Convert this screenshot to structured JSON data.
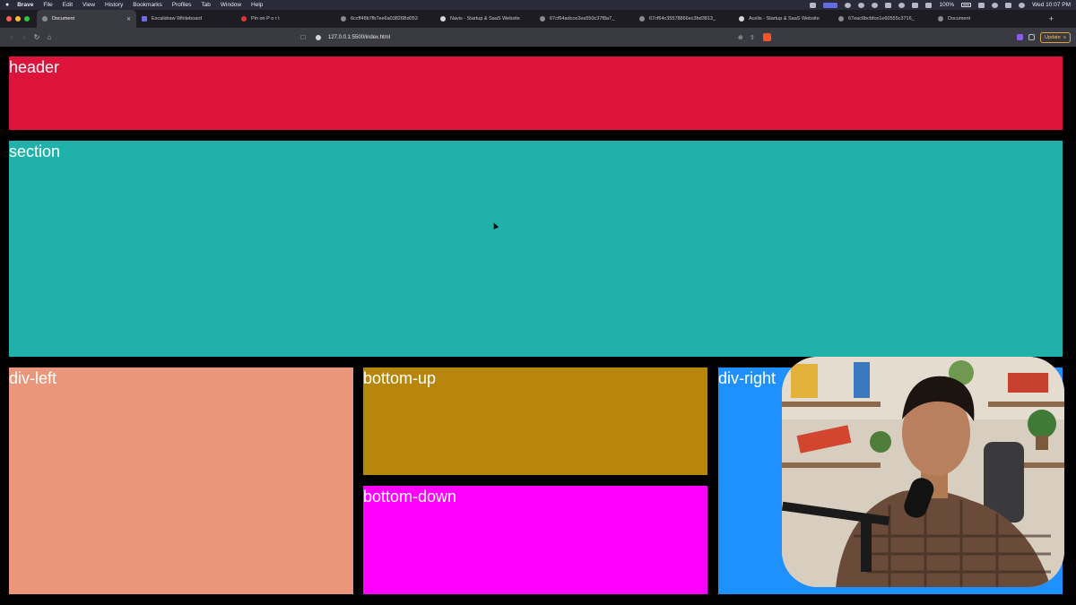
{
  "menubar": {
    "app": "Brave",
    "items": [
      "File",
      "Edit",
      "View",
      "History",
      "Bookmarks",
      "Profiles",
      "Tab",
      "Window",
      "Help"
    ],
    "battery": "100%",
    "clock": "Wed 10:07 PM"
  },
  "tabs": [
    {
      "label": "Document",
      "active": true
    },
    {
      "label": "Excalidraw Whiteboard"
    },
    {
      "label": "Pin on P o r t"
    },
    {
      "label": "6ccff48b7fb7ee6a03826Bd053"
    },
    {
      "label": "Navis - Startup & SaaS Website"
    },
    {
      "label": "67cf64adcce2ea550c37f8a7_"
    },
    {
      "label": "67cf64c35578866ec3bd3813_"
    },
    {
      "label": "Acelis - Startup & SaaS Website"
    },
    {
      "label": "67eac6bcbfce1e60555c3716_"
    },
    {
      "label": "Document"
    }
  ],
  "toolbar": {
    "url": "127.0.0.1:5500/index.html",
    "update_label": "Update"
  },
  "page": {
    "header": "header",
    "section": "section",
    "div_left": "div-left",
    "bottom_up": "bottom-up",
    "bottom_down": "bottom-down",
    "div_right": "div-right"
  },
  "colors": {
    "header": "#dc143c",
    "section": "#20b2aa",
    "div_left": "#e9967a",
    "bottom_up": "#b8860b",
    "bottom_down": "#ff00ff",
    "div_right": "#1e90ff",
    "page_background": "#000000"
  }
}
